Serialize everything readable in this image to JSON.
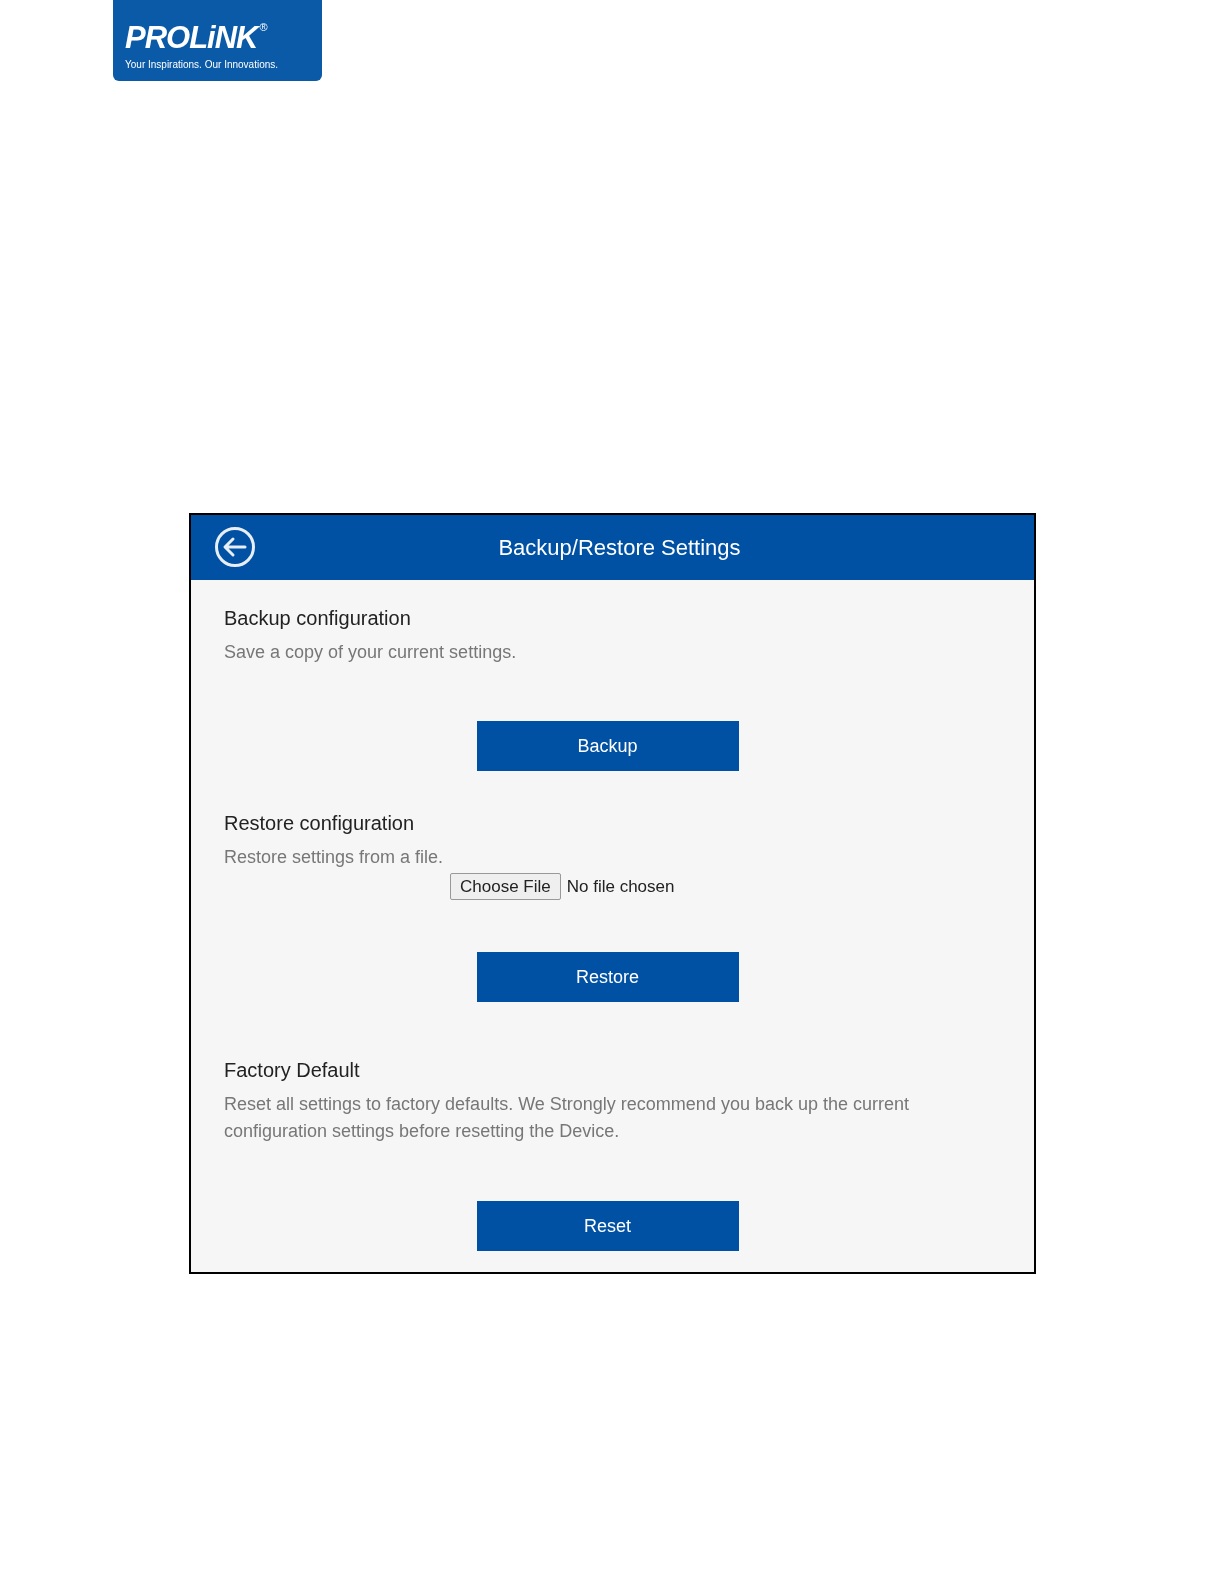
{
  "logo": {
    "name": "PROLiNK",
    "mark": "®",
    "tagline": "Your Inspirations. Our Innovations."
  },
  "panel": {
    "title": "Backup/Restore Settings",
    "sections": [
      {
        "kind": "button",
        "heading": "Backup configuration",
        "description": "Save a copy of your current settings.",
        "button": "Backup"
      },
      {
        "kind": "file",
        "heading": "Restore configuration",
        "description": "Restore settings from a file.",
        "file_button": "Choose File",
        "file_status": "No file chosen",
        "button": "Restore"
      },
      {
        "kind": "button",
        "heading": "Factory Default",
        "description": "Reset all settings to factory defaults. We Strongly recommend you back up the current configuration settings before resetting the Device.",
        "button": "Reset"
      }
    ]
  }
}
